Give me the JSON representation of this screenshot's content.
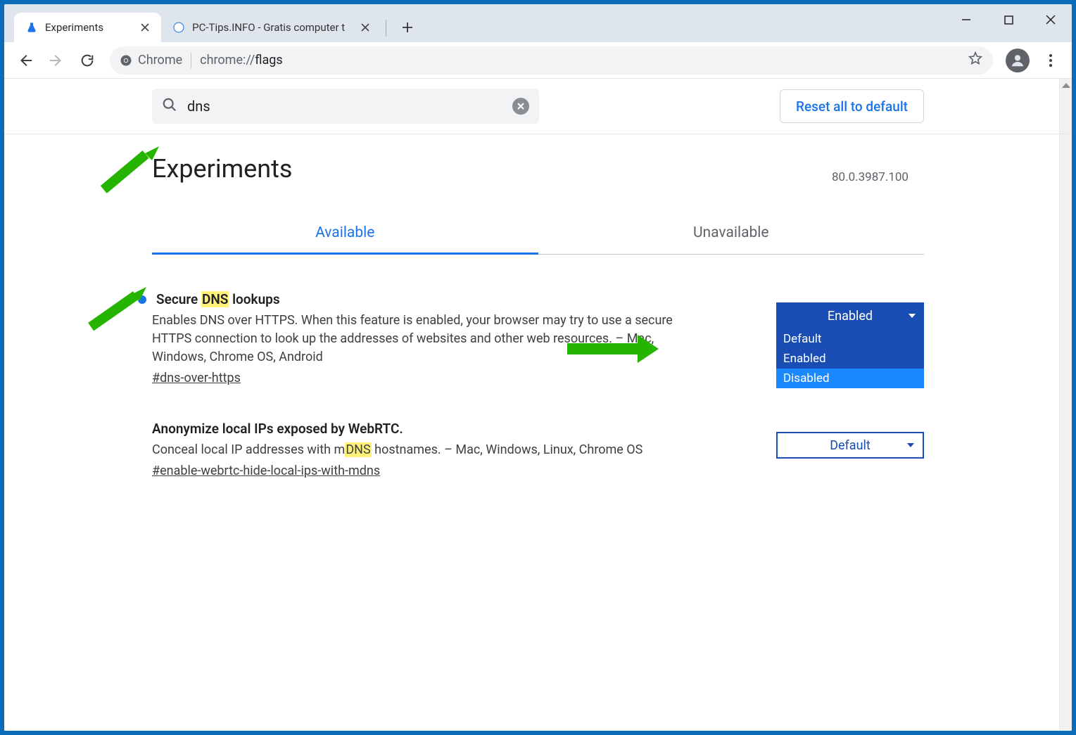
{
  "window": {
    "tabs": [
      {
        "title": "Experiments",
        "active": true,
        "icon": "flask"
      },
      {
        "title": "PC-Tips.INFO - Gratis computer t",
        "active": false,
        "icon": "globe"
      }
    ],
    "controls": {
      "minimize": "–",
      "maximize": "▢",
      "close": "✕"
    }
  },
  "toolbar": {
    "back": true,
    "forward_disabled": true,
    "reload": true,
    "omnibox": {
      "badge_label": "Chrome",
      "url_prefix": "chrome://",
      "url_bold": "flags"
    }
  },
  "flags_page": {
    "search_value": "dns",
    "reset_label": "Reset all to default",
    "heading": "Experiments",
    "version": "80.0.3987.100",
    "tab_available": "Available",
    "tab_unavailable": "Unavailable",
    "items": [
      {
        "modified": true,
        "title_pre": "Secure ",
        "title_hl": "DNS",
        "title_post": " lookups",
        "description": "Enables DNS over HTTPS. When this feature is enabled, your browser may try to use a secure HTTPS connection to look up the addresses of websites and other web resources. – Mac, Windows, Chrome OS, Android",
        "anchor": "#dns-over-https",
        "dropdown": {
          "selected": "Enabled",
          "style": "solid",
          "open": true,
          "options": [
            "Default",
            "Enabled",
            "Disabled"
          ],
          "hover_index": 2
        }
      },
      {
        "modified": false,
        "title_plain": "Anonymize local IPs exposed by WebRTC.",
        "desc_pre": "Conceal local IP addresses with m",
        "desc_hl": "DNS",
        "desc_post": " hostnames. – Mac, Windows, Linux, Chrome OS",
        "anchor": "#enable-webrtc-hide-local-ips-with-mdns",
        "dropdown": {
          "selected": "Default",
          "style": "outline",
          "open": false
        }
      }
    ]
  }
}
